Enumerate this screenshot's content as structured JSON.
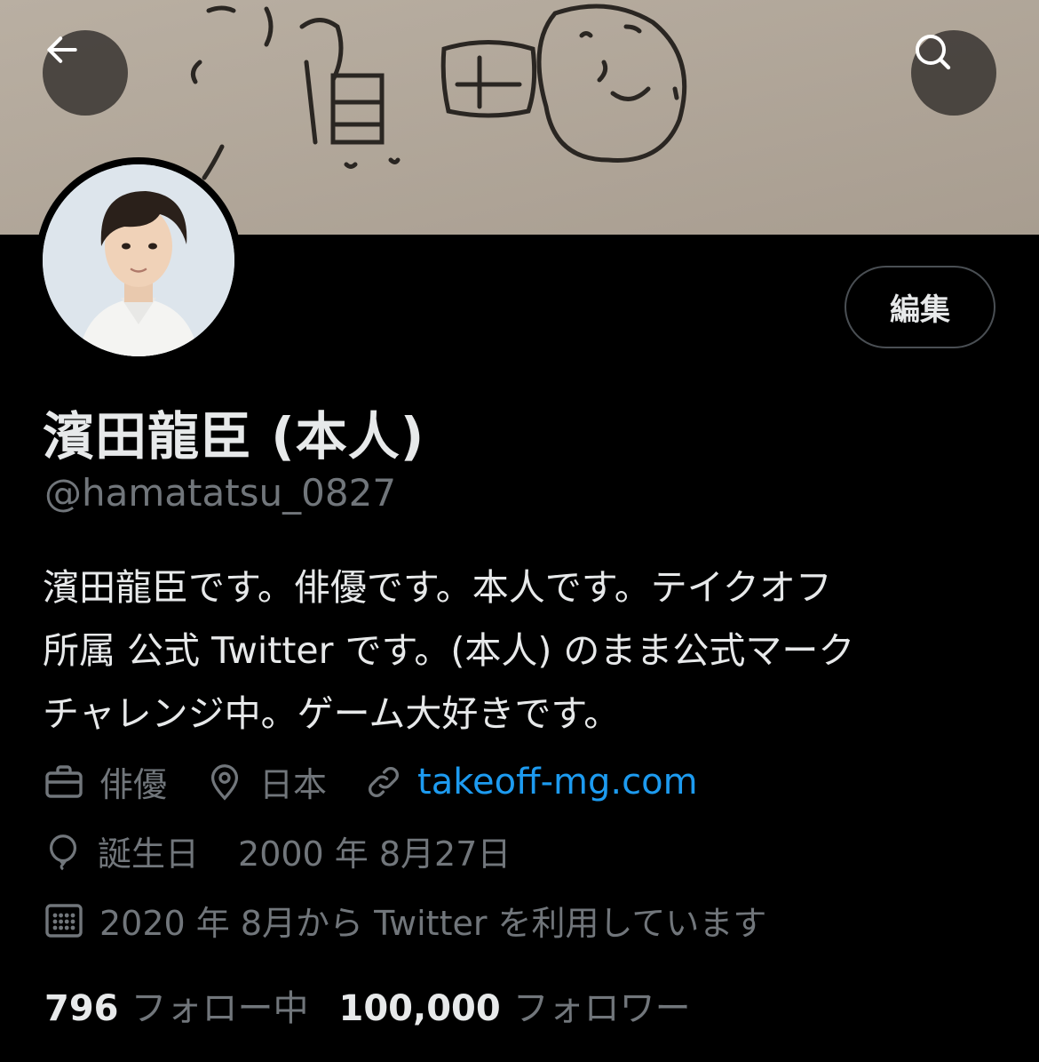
{
  "header": {
    "back_icon": "arrow-left-icon",
    "search_icon": "search-icon"
  },
  "profile": {
    "display_name": "濱田龍臣 (本人)",
    "handle": "@hamatatsu_0827",
    "edit_label": "編集",
    "bio_lines": [
      "濱田龍臣です。俳優です。本人です。テイクオフ",
      "所属 公式 Twitter です。(本人) のまま公式マーク",
      "チャレンジ中。ゲーム大好きです。"
    ],
    "profession": "俳優",
    "location": "日本",
    "website": "takeoff-mg.com",
    "birthday_label": "誕生日",
    "birthday": "2000 年 8月27日",
    "joined": "2020 年 8月から Twitter を利用しています",
    "following_count": "796",
    "following_label": "フォロー中",
    "followers_count": "100,000",
    "followers_label": "フォロワー"
  },
  "colors": {
    "background": "#000000",
    "text": "#e7e9ea",
    "muted": "#71767b",
    "link": "#1d9bf0",
    "banner": "#b2a799"
  }
}
